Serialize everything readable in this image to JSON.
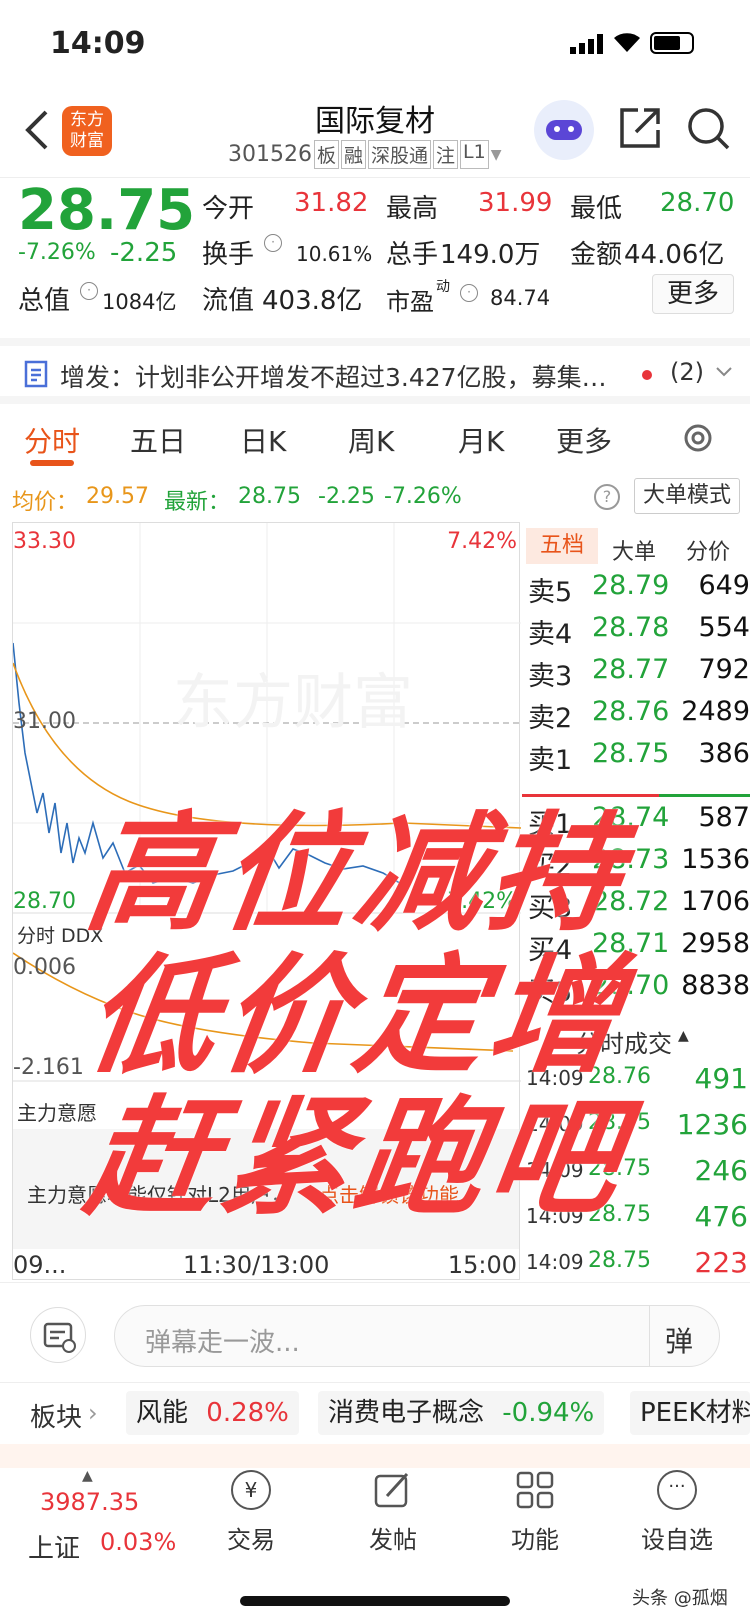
{
  "status": {
    "time": "14:09"
  },
  "nav": {
    "logo_line1": "东方",
    "logo_line2": "财富",
    "title": "国际复材",
    "code": "301526",
    "tags": [
      "板",
      "融",
      "深股通",
      "注",
      "L1"
    ]
  },
  "quote": {
    "price": "28.75",
    "pct": "-7.26%",
    "chg": "-2.25",
    "open_label": "今开",
    "open": "31.82",
    "high_label": "最高",
    "high": "31.99",
    "low_label": "最低",
    "low": "28.70",
    "turnover_label": "换手",
    "turnover": "10.61%",
    "volume_label": "总手",
    "volume": "149.0万",
    "amount_label": "金额",
    "amount": "44.06亿",
    "mcap_label": "总值",
    "mcap": "1084亿",
    "float_label": "流值",
    "float": "403.8亿",
    "pe_label": "市盈",
    "pe_sup": "动",
    "pe": "84.74",
    "more": "更多"
  },
  "notice": {
    "text": "增发：计划非公开增发不超过3.427亿股，募集…",
    "count": "(2)"
  },
  "tabs": [
    "分时",
    "五日",
    "日K",
    "周K",
    "月K",
    "更多"
  ],
  "avgline": {
    "avg_label": "均价：",
    "avg": "29.57",
    "latest_label": "最新：",
    "latest": "28.75",
    "chg": "-2.25",
    "pct": "-7.26%",
    "mode": "大单模式"
  },
  "chart": {
    "top_price": "33.30",
    "top_pct": "7.42%",
    "mid_price": "31.00",
    "bot_price": "28.70",
    "bot_pct": "-7.42%",
    "ddx_label": "分时 DDX",
    "ddx_val": "0.006",
    "ddx_min": "-2.161",
    "force_label": "主力意愿",
    "l2_text": "主力意愿功能仅针对L2用户，",
    "l2_link": "点击解锁该功能",
    "t_start": "09...",
    "t_mid": "11:30/13:00",
    "t_end": "15:00",
    "watermark": "东方财富"
  },
  "book": {
    "tabs": [
      "五档",
      "大单",
      "分价"
    ],
    "asks": [
      {
        "label": "卖5",
        "price": "28.79",
        "vol": "649"
      },
      {
        "label": "卖4",
        "price": "28.78",
        "vol": "554"
      },
      {
        "label": "卖3",
        "price": "28.77",
        "vol": "792"
      },
      {
        "label": "卖2",
        "price": "28.76",
        "vol": "2489"
      },
      {
        "label": "卖1",
        "price": "28.75",
        "vol": "386"
      }
    ],
    "bids": [
      {
        "label": "买1",
        "price": "28.74",
        "vol": "587"
      },
      {
        "label": "买2",
        "price": "28.73",
        "vol": "1536"
      },
      {
        "label": "买3",
        "price": "28.72",
        "vol": "1706"
      },
      {
        "label": "买4",
        "price": "28.71",
        "vol": "2958"
      },
      {
        "label": "买5",
        "price": "28.70",
        "vol": "8838"
      }
    ],
    "trades_title": "分时成交",
    "trades": [
      {
        "time": "14:09",
        "price": "28.76",
        "vol": "491"
      },
      {
        "time": "14:09",
        "price": "28.75",
        "vol": "1236"
      },
      {
        "time": "14:09",
        "price": "28.75",
        "vol": "246"
      },
      {
        "time": "14:09",
        "price": "28.75",
        "vol": "476"
      },
      {
        "time": "14:09",
        "price": "28.75",
        "vol": "223"
      }
    ]
  },
  "chat": {
    "placeholder": "弹幕走一波...",
    "btn": "弹"
  },
  "sectors": {
    "label": "板块",
    "items": [
      {
        "name": "风能",
        "pct": "0.28%"
      },
      {
        "name": "消费电子概念",
        "pct": "-0.94%"
      },
      {
        "name": "PEEK材料",
        "pct": ""
      }
    ]
  },
  "bottom": {
    "index_value": "3987.35",
    "index_name": "上证",
    "index_pct": "0.03%",
    "items": [
      "交易",
      "发帖",
      "功能",
      "设自选"
    ]
  },
  "overlay": [
    "高位减持",
    "低价定增",
    "赶紧跑吧"
  ],
  "watermark": "头条 @孤烟"
}
